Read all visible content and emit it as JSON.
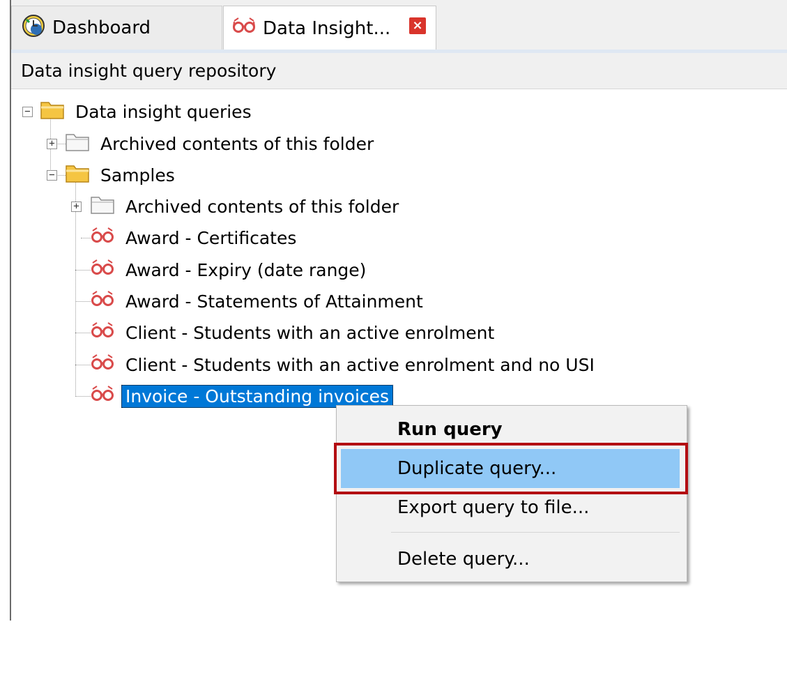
{
  "tabs": [
    {
      "label": "Dashboard",
      "icon": "dashboard-clock-icon",
      "active": false
    },
    {
      "label": "Data Insight...",
      "icon": "glasses-icon",
      "active": true,
      "closable": true
    }
  ],
  "panel": {
    "title": "Data insight query repository"
  },
  "tree": {
    "root": {
      "label": "Data insight queries",
      "expanded": true
    },
    "archived_root": {
      "label": "Archived contents of this folder",
      "expanded": false
    },
    "samples": {
      "label": "Samples",
      "expanded": true
    },
    "archived_samples": {
      "label": "Archived contents of this folder",
      "expanded": false
    },
    "queries": [
      {
        "label": "Award - Certificates"
      },
      {
        "label": "Award - Expiry (date range)"
      },
      {
        "label": "Award - Statements of Attainment"
      },
      {
        "label": "Client - Students with an active enrolment"
      },
      {
        "label": "Client - Students with an active enrolment and no USI"
      },
      {
        "label": "Invoice - Outstanding invoices",
        "selected": true
      }
    ]
  },
  "context_menu": {
    "items": [
      {
        "label": "Run query",
        "bold": true
      },
      {
        "label": "Duplicate query...",
        "highlighted": true
      },
      {
        "label": "Export query to file..."
      },
      {
        "label": "Delete query..."
      }
    ]
  },
  "colors": {
    "selection": "#0078d7",
    "menu_highlight": "#90c8f6",
    "callout_box": "#b30d12",
    "close_button": "#d9342b"
  }
}
